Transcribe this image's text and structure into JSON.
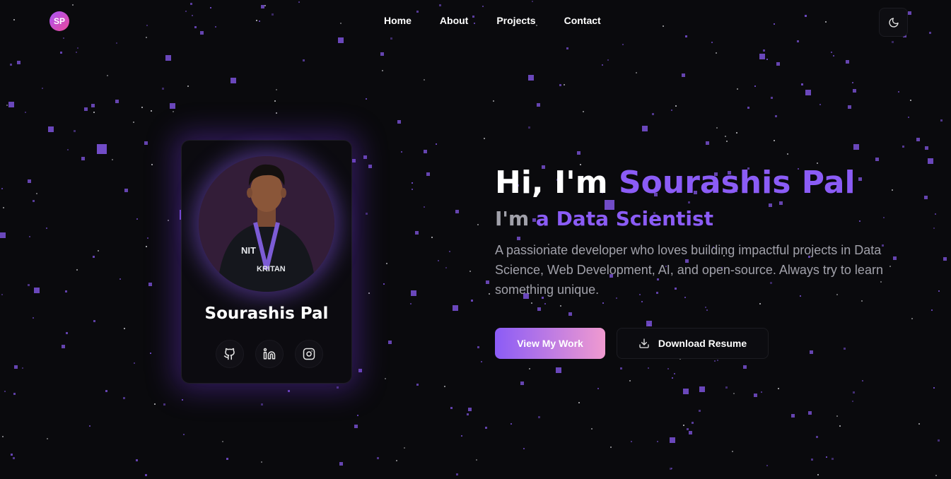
{
  "header": {
    "logo_text": "SP",
    "nav": [
      "Home",
      "About",
      "Projects",
      "Contact"
    ],
    "theme_icon": "moon-icon"
  },
  "profile": {
    "name": "Sourashis Pal",
    "photo": "portrait-photo",
    "socials": [
      "github-icon",
      "linkedin-icon",
      "instagram-icon"
    ]
  },
  "hero": {
    "greeting": "Hi, I'm",
    "name": "Sourashis Pal",
    "role_prefix": "I'm",
    "role": "a Data Scientist",
    "description": "A passionate developer who loves building impactful projects in Data Science, Web Development, AI, and open-source. Always try to learn something unique.",
    "primary_button": "View My Work",
    "secondary_button": "Download Resume",
    "download_icon": "download-icon"
  },
  "colors": {
    "background": "#0a0a0d",
    "accent": "#8b5cf6",
    "gradient_end": "#f09ad0"
  }
}
